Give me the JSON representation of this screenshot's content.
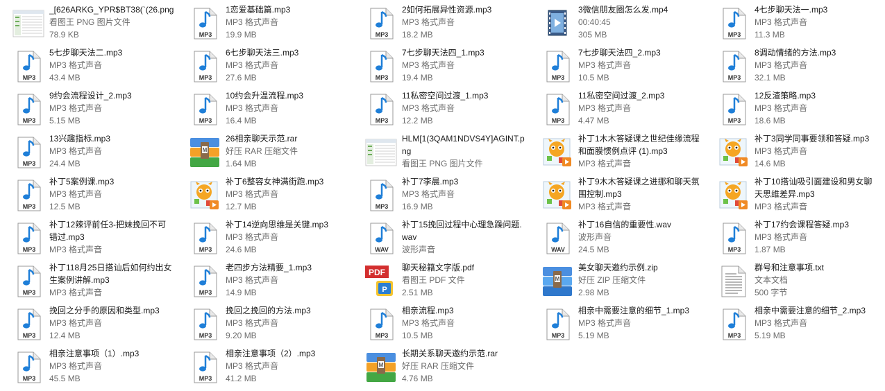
{
  "files": [
    {
      "name": "_[626ARKG_YPR$BT38(`(26.png",
      "line2": "看图王 PNG 图片文件",
      "line3": "78.9 KB",
      "icon": "png-thumbnail-icon",
      "wrap": false
    },
    {
      "name": "1恋爱基础篇.mp3",
      "line2": "MP3 格式声音",
      "line3": "19.9 MB",
      "icon": "mp3-file-icon",
      "wrap": false
    },
    {
      "name": "2如何拓展异性资源.mp3",
      "line2": "MP3 格式声音",
      "line3": "18.2 MB",
      "icon": "mp3-file-icon",
      "wrap": false
    },
    {
      "name": "3微信朋友圈怎么发.mp4",
      "line2": "00:40:45",
      "line3": "305 MB",
      "icon": "mp4-video-icon",
      "wrap": false
    },
    {
      "name": "4七步聊天法一.mp3",
      "line2": "MP3 格式声音",
      "line3": "11.3 MB",
      "icon": "mp3-file-icon",
      "wrap": false
    },
    {
      "name": "5七步聊天法二.mp3",
      "line2": "MP3 格式声音",
      "line3": "43.4 MB",
      "icon": "mp3-file-icon",
      "wrap": false
    },
    {
      "name": "6七步聊天法三.mp3",
      "line2": "MP3 格式声音",
      "line3": "27.6 MB",
      "icon": "mp3-file-icon",
      "wrap": false
    },
    {
      "name": "7七步聊天法四_1.mp3",
      "line2": "MP3 格式声音",
      "line3": "19.4 MB",
      "icon": "mp3-file-icon",
      "wrap": false
    },
    {
      "name": "7七步聊天法四_2.mp3",
      "line2": "MP3 格式声音",
      "line3": "10.5 MB",
      "icon": "mp3-file-icon",
      "wrap": false
    },
    {
      "name": "8调动情绪的方法.mp3",
      "line2": "MP3 格式声音",
      "line3": "32.1 MB",
      "icon": "mp3-file-icon",
      "wrap": false
    },
    {
      "name": "9约会流程设计_2.mp3",
      "line2": "MP3 格式声音",
      "line3": "5.15 MB",
      "icon": "mp3-file-icon",
      "wrap": false
    },
    {
      "name": "10约会升温流程.mp3",
      "line2": "MP3 格式声音",
      "line3": "16.4 MB",
      "icon": "mp3-file-icon",
      "wrap": false
    },
    {
      "name": "11私密空间过渡_1.mp3",
      "line2": "MP3 格式声音",
      "line3": "12.2 MB",
      "icon": "mp3-file-icon",
      "wrap": false
    },
    {
      "name": "11私密空间过渡_2.mp3",
      "line2": "MP3 格式声音",
      "line3": "4.47 MB",
      "icon": "mp3-file-icon",
      "wrap": false
    },
    {
      "name": "12反渣策略.mp3",
      "line2": "MP3 格式声音",
      "line3": "18.6 MB",
      "icon": "mp3-file-icon",
      "wrap": false
    },
    {
      "name": "13兴趣指标.mp3",
      "line2": "MP3 格式声音",
      "line3": "24.4 MB",
      "icon": "mp3-file-icon",
      "wrap": false
    },
    {
      "name": "26相亲聊天示范.rar",
      "line2": "好压 RAR 压缩文件",
      "line3": "1.64 MB",
      "icon": "rar-archive-icon",
      "wrap": false
    },
    {
      "name": "HLM[1(3QAM1NDVS4Y]AGINT.png",
      "line2": "看图王 PNG 图片文件",
      "line3": "",
      "icon": "png-thumbnail-icon",
      "wrap": true
    },
    {
      "name": "补丁1木木答疑课之世纪佳缘流程和面膜惯例点评 (1).mp3",
      "line2": "MP3 格式声音",
      "line3": "",
      "icon": "media-player-icon",
      "wrap": true
    },
    {
      "name": "补丁3同学同事要领和答疑.mp3",
      "line2": "MP3 格式声音",
      "line3": "14.6 MB",
      "icon": "media-player-icon",
      "wrap": false
    },
    {
      "name": "补丁5案例课.mp3",
      "line2": "MP3 格式声音",
      "line3": "12.5 MB",
      "icon": "mp3-file-icon",
      "wrap": false
    },
    {
      "name": "补丁6整容女神满街跑.mp3",
      "line2": "MP3 格式声音",
      "line3": "12.7 MB",
      "icon": "media-player-icon",
      "wrap": false
    },
    {
      "name": "补丁7李晨.mp3",
      "line2": "MP3 格式声音",
      "line3": "16.9 MB",
      "icon": "mp3-file-icon",
      "wrap": false
    },
    {
      "name": "补丁9木木答疑课之进挪和聊天氛围控制.mp3",
      "line2": "MP3 格式声音",
      "line3": "",
      "icon": "media-player-icon",
      "wrap": true
    },
    {
      "name": "补丁10搭讪吸引面建设和男女聊天思维差异.mp3",
      "line2": "MP3 格式声音",
      "line3": "",
      "icon": "media-player-icon",
      "wrap": true
    },
    {
      "name": "补丁12辣评前任3-把妹挽回不可错过.mp3",
      "line2": "MP3 格式声音",
      "line3": "",
      "icon": "mp3-file-icon",
      "wrap": true
    },
    {
      "name": "补丁14逆向思维是关键.mp3",
      "line2": "MP3 格式声音",
      "line3": "24.6 MB",
      "icon": "mp3-file-icon",
      "wrap": false
    },
    {
      "name": "补丁15挽回过程中心理急躁问题.wav",
      "line2": "波形声音",
      "line3": "",
      "icon": "wav-file-icon",
      "wrap": true
    },
    {
      "name": "补丁16自信的重要性.wav",
      "line2": "波形声音",
      "line3": "24.5 MB",
      "icon": "wav-file-icon",
      "wrap": false
    },
    {
      "name": "补丁17约会课程答疑.mp3",
      "line2": "MP3 格式声音",
      "line3": "1.87 MB",
      "icon": "mp3-file-icon",
      "wrap": false
    },
    {
      "name": "补丁118月25日搭讪后如何约出女生案例讲解.mp3",
      "line2": "MP3 格式声音",
      "line3": "",
      "icon": "mp3-file-icon",
      "wrap": true
    },
    {
      "name": "老四步方法精要_1.mp3",
      "line2": "MP3 格式声音",
      "line3": "14.9 MB",
      "icon": "mp3-file-icon",
      "wrap": false
    },
    {
      "name": "聊天秘籍文字版.pdf",
      "line2": "看图王 PDF 文件",
      "line3": "2.51 MB",
      "icon": "pdf-file-icon",
      "wrap": false
    },
    {
      "name": "美女聊天邀约示例.zip",
      "line2": "好压 ZIP 压缩文件",
      "line3": "2.98 MB",
      "icon": "zip-archive-icon",
      "wrap": false
    },
    {
      "name": "群号和注意事项.txt",
      "line2": "文本文档",
      "line3": "500 字节",
      "icon": "txt-file-icon",
      "wrap": false
    },
    {
      "name": "挽回之分手的原因和类型.mp3",
      "line2": "MP3 格式声音",
      "line3": "12.4 MB",
      "icon": "mp3-file-icon",
      "wrap": false
    },
    {
      "name": "挽回之挽回的方法.mp3",
      "line2": "MP3 格式声音",
      "line3": "9.20 MB",
      "icon": "mp3-file-icon",
      "wrap": false
    },
    {
      "name": "相亲流程.mp3",
      "line2": "MP3 格式声音",
      "line3": "10.5 MB",
      "icon": "mp3-file-icon",
      "wrap": false
    },
    {
      "name": "相亲中需要注意的细节_1.mp3",
      "line2": "MP3 格式声音",
      "line3": "5.19 MB",
      "icon": "mp3-file-icon",
      "wrap": false
    },
    {
      "name": "相亲中需要注意的细节_2.mp3",
      "line2": "MP3 格式声音",
      "line3": "5.19 MB",
      "icon": "mp3-file-icon",
      "wrap": false
    },
    {
      "name": "相亲注意事项（1）.mp3",
      "line2": "MP3 格式声音",
      "line3": "45.5 MB",
      "icon": "mp3-file-icon",
      "wrap": false
    },
    {
      "name": "相亲注意事项（2）.mp3",
      "line2": "MP3 格式声音",
      "line3": "41.2 MB",
      "icon": "mp3-file-icon",
      "wrap": false
    },
    {
      "name": "长期关系聊天邀约示范.rar",
      "line2": "好压 RAR 压缩文件",
      "line3": "4.76 MB",
      "icon": "rar-archive-icon",
      "wrap": false
    }
  ],
  "colors": {
    "text": "#1a1a1a",
    "meta": "#6d6d6d",
    "note": "#2a7fd4"
  }
}
